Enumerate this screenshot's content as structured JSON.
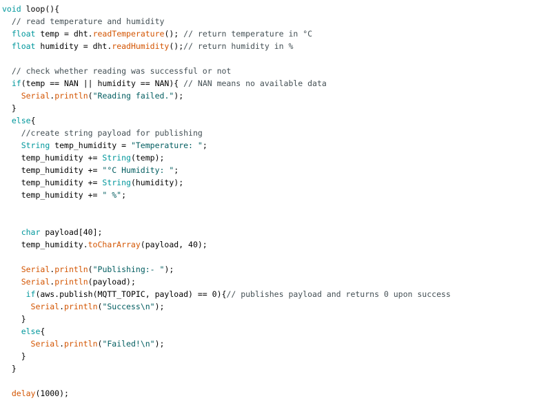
{
  "editor": {
    "colors": {
      "background": "#ffffff",
      "keyword": "#00979C",
      "function": "#D35400",
      "string": "#005C5F",
      "comment": "#434F54",
      "plain": "#000000"
    },
    "lines": [
      [
        [
          "kw",
          "void"
        ],
        [
          "p",
          " loop(){"
        ]
      ],
      [
        [
          "p",
          "  "
        ],
        [
          "com",
          "// read temperature and humidity"
        ]
      ],
      [
        [
          "p",
          "  "
        ],
        [
          "kw",
          "float"
        ],
        [
          "p",
          " temp = dht."
        ],
        [
          "fn",
          "readTemperature"
        ],
        [
          "p",
          "(); "
        ],
        [
          "com",
          "// return temperature in °C"
        ]
      ],
      [
        [
          "p",
          "  "
        ],
        [
          "kw",
          "float"
        ],
        [
          "p",
          " humidity = dht."
        ],
        [
          "fn",
          "readHumidity"
        ],
        [
          "p",
          "();"
        ],
        [
          "com",
          "// return humidity in %"
        ]
      ],
      [],
      [
        [
          "p",
          "  "
        ],
        [
          "com",
          "// check whether reading was successful or not"
        ]
      ],
      [
        [
          "p",
          "  "
        ],
        [
          "kw",
          "if"
        ],
        [
          "p",
          "(temp == NAN || humidity == NAN){ "
        ],
        [
          "com",
          "// NAN means no available data"
        ]
      ],
      [
        [
          "p",
          "    "
        ],
        [
          "fn",
          "Serial"
        ],
        [
          "p",
          "."
        ],
        [
          "fn",
          "println"
        ],
        [
          "p",
          "("
        ],
        [
          "str",
          "\"Reading failed.\""
        ],
        [
          "p",
          ");"
        ]
      ],
      [
        [
          "p",
          "  }"
        ]
      ],
      [
        [
          "p",
          "  "
        ],
        [
          "kw",
          "else"
        ],
        [
          "p",
          "{"
        ]
      ],
      [
        [
          "p",
          "    "
        ],
        [
          "com",
          "//create string payload for publishing"
        ]
      ],
      [
        [
          "p",
          "    "
        ],
        [
          "kw",
          "String"
        ],
        [
          "p",
          " temp_humidity = "
        ],
        [
          "str",
          "\"Temperature: \""
        ],
        [
          "p",
          ";"
        ]
      ],
      [
        [
          "p",
          "    temp_humidity += "
        ],
        [
          "kw",
          "String"
        ],
        [
          "p",
          "(temp);"
        ]
      ],
      [
        [
          "p",
          "    temp_humidity += "
        ],
        [
          "str",
          "\"°C Humidity: \""
        ],
        [
          "p",
          ";"
        ]
      ],
      [
        [
          "p",
          "    temp_humidity += "
        ],
        [
          "kw",
          "String"
        ],
        [
          "p",
          "(humidity);"
        ]
      ],
      [
        [
          "p",
          "    temp_humidity += "
        ],
        [
          "str",
          "\" %\""
        ],
        [
          "p",
          ";"
        ]
      ],
      [],
      [],
      [
        [
          "p",
          "    "
        ],
        [
          "kw",
          "char"
        ],
        [
          "p",
          " payload[40];"
        ]
      ],
      [
        [
          "p",
          "    temp_humidity."
        ],
        [
          "fn",
          "toCharArray"
        ],
        [
          "p",
          "(payload, 40);"
        ]
      ],
      [],
      [
        [
          "p",
          "    "
        ],
        [
          "fn",
          "Serial"
        ],
        [
          "p",
          "."
        ],
        [
          "fn",
          "println"
        ],
        [
          "p",
          "("
        ],
        [
          "str",
          "\"Publishing:- \""
        ],
        [
          "p",
          ");"
        ]
      ],
      [
        [
          "p",
          "    "
        ],
        [
          "fn",
          "Serial"
        ],
        [
          "p",
          "."
        ],
        [
          "fn",
          "println"
        ],
        [
          "p",
          "(payload);"
        ]
      ],
      [
        [
          "p",
          "     "
        ],
        [
          "kw",
          "if"
        ],
        [
          "p",
          "(aws.publish(MQTT_TOPIC, payload) == 0){"
        ],
        [
          "com",
          "// publishes payload and returns 0 upon success"
        ]
      ],
      [
        [
          "p",
          "      "
        ],
        [
          "fn",
          "Serial"
        ],
        [
          "p",
          "."
        ],
        [
          "fn",
          "println"
        ],
        [
          "p",
          "("
        ],
        [
          "str",
          "\"Success\\n\""
        ],
        [
          "p",
          ");"
        ]
      ],
      [
        [
          "p",
          "    }"
        ]
      ],
      [
        [
          "p",
          "    "
        ],
        [
          "kw",
          "else"
        ],
        [
          "p",
          "{"
        ]
      ],
      [
        [
          "p",
          "      "
        ],
        [
          "fn",
          "Serial"
        ],
        [
          "p",
          "."
        ],
        [
          "fn",
          "println"
        ],
        [
          "p",
          "("
        ],
        [
          "str",
          "\"Failed!\\n\""
        ],
        [
          "p",
          ");"
        ]
      ],
      [
        [
          "p",
          "    }"
        ]
      ],
      [
        [
          "p",
          "  }"
        ]
      ],
      [],
      [
        [
          "p",
          "  "
        ],
        [
          "fn",
          "delay"
        ],
        [
          "p",
          "(1000);"
        ]
      ]
    ]
  }
}
